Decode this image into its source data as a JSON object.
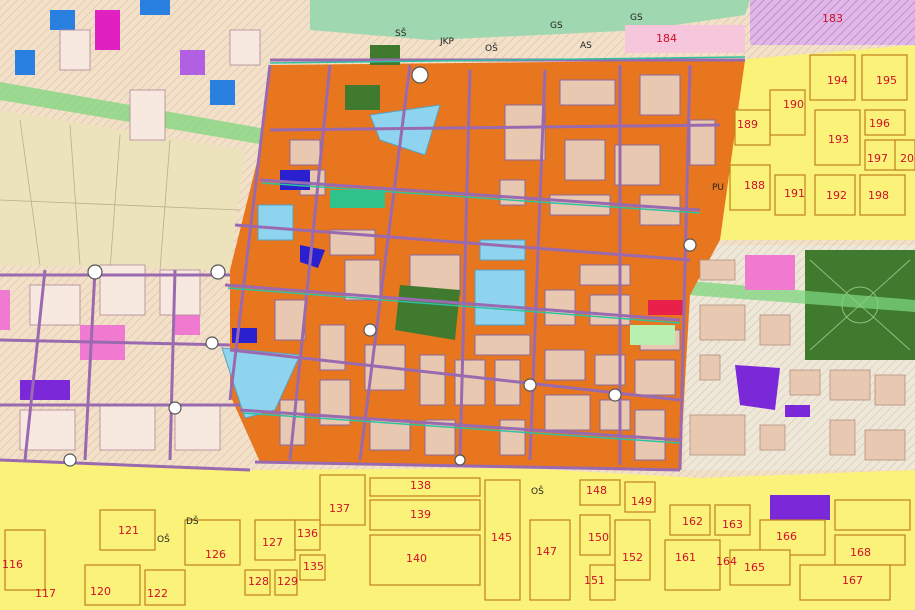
{
  "map": {
    "plot_numbers": {
      "p183": "183",
      "p184": "184",
      "p189": "189",
      "p190": "190",
      "p194": "194",
      "p195": "195",
      "p196": "196",
      "p193": "193",
      "p197": "197",
      "p20": "20",
      "p188": "188",
      "p191": "191",
      "p192": "192",
      "p198": "198",
      "p137": "137",
      "p138": "138",
      "p139": "139",
      "p148": "148",
      "p149": "149",
      "p162": "162",
      "p163": "163",
      "p166": "166",
      "p168": "168",
      "p121": "121",
      "p126": "126",
      "p127": "127",
      "p136": "136",
      "p140": "140",
      "p145": "145",
      "p147": "147",
      "p150": "150",
      "p152": "152",
      "p161": "161",
      "p164": "164",
      "p165": "165",
      "p167": "167",
      "p116": "116",
      "p117": "117",
      "p120": "120",
      "p122": "122",
      "p128": "128",
      "p129": "129",
      "p135": "135",
      "p151": "151",
      "p165top": "165"
    },
    "zone_codes": {
      "ss": "SŠ",
      "jkp": "JKP",
      "os_top": "OŠ",
      "as": "AS",
      "pu": "PU",
      "os_mid": "OŠ",
      "os_left": "OŠ",
      "ds": "DŠ",
      "gs1": "GS",
      "gs2": "GS"
    },
    "colors": {
      "residential_yellow": "#fbf27a",
      "mixed_orange": "#e8761e",
      "block_beige": "#e8c8b0",
      "school_blue": "#8fd4ef",
      "street_purple": "#9a6ab0",
      "greenway": "#7ed67e",
      "park_green": "#3f7a2e",
      "magenta": "#f07ad0",
      "violet": "#7a28d8",
      "navy": "#2a20d0"
    }
  }
}
